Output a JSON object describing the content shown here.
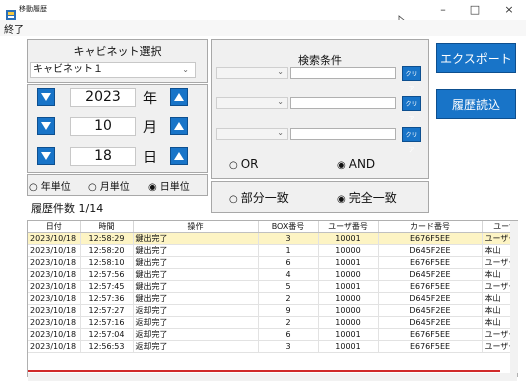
{
  "window": {
    "title": "移動履歴",
    "minimize": "–",
    "maximize": "□",
    "close": "×"
  },
  "menu": {
    "exit": "終了"
  },
  "cabinet": {
    "title": "キャビネット選択",
    "selected": "キャビネット１"
  },
  "date": {
    "year": "2023",
    "year_unit": "年",
    "month": "10",
    "month_unit": "月",
    "day": "18",
    "day_unit": "日"
  },
  "unit_options": {
    "year": "年単位",
    "month": "月単位",
    "day": "日単位",
    "selected": "day"
  },
  "history_count": "履歴件数 1/14",
  "search": {
    "title": "検索条件",
    "clear_label": "クリア",
    "or_label": "OR",
    "and_label": "AND",
    "logic_selected": "AND",
    "partial_label": "部分一致",
    "exact_label": "完全一致",
    "match_selected": "exact"
  },
  "buttons": {
    "export": "エクスポート",
    "load_history": "履歴読込"
  },
  "colors": {
    "accent": "#1874c8",
    "selected_row": "#fdf4c4",
    "marker_line": "#d12b2b"
  },
  "table": {
    "headers": [
      "日付",
      "時間",
      "操作",
      "BOX番号",
      "ユーザ番号",
      "カード番号",
      "ユーザ"
    ],
    "rows": [
      [
        "2023/10/18",
        "12:58:29",
        "鍵出完了",
        "3",
        "10001",
        "E676F5EE",
        "ユーザー"
      ],
      [
        "2023/10/18",
        "12:58:20",
        "鍵出完了",
        "1",
        "10000",
        "D645F2EE",
        "本山"
      ],
      [
        "2023/10/18",
        "12:58:10",
        "鍵出完了",
        "6",
        "10001",
        "E676F5EE",
        "ユーザー"
      ],
      [
        "2023/10/18",
        "12:57:56",
        "鍵出完了",
        "4",
        "10000",
        "D645F2EE",
        "本山"
      ],
      [
        "2023/10/18",
        "12:57:45",
        "鍵出完了",
        "5",
        "10001",
        "E676F5EE",
        "ユーザー"
      ],
      [
        "2023/10/18",
        "12:57:36",
        "鍵出完了",
        "2",
        "10000",
        "D645F2EE",
        "本山"
      ],
      [
        "2023/10/18",
        "12:57:27",
        "返却完了",
        "9",
        "10000",
        "D645F2EE",
        "本山"
      ],
      [
        "2023/10/18",
        "12:57:16",
        "返却完了",
        "2",
        "10000",
        "D645F2EE",
        "本山"
      ],
      [
        "2023/10/18",
        "12:57:04",
        "返却完了",
        "6",
        "10001",
        "E676F5EE",
        "ユーザー"
      ],
      [
        "2023/10/18",
        "12:56:53",
        "返却完了",
        "3",
        "10001",
        "E676F5EE",
        "ユーザー"
      ]
    ]
  }
}
